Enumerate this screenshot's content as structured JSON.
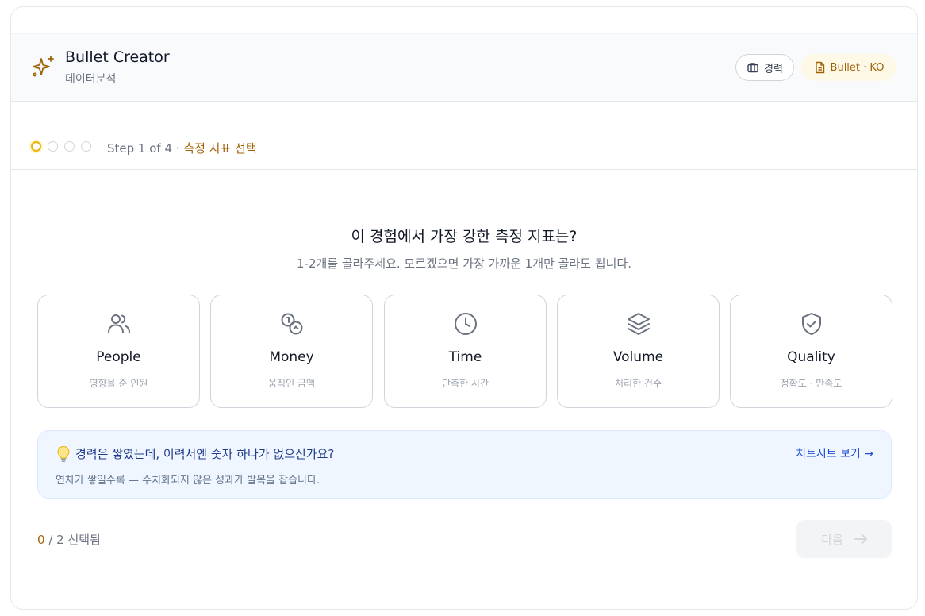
{
  "header": {
    "title": "Bullet Creator",
    "subtitle": "데이터분석",
    "chip_career": "경력",
    "chip_bullet": "Bullet · KO"
  },
  "stepper": {
    "current_step": 1,
    "total_steps": 4,
    "label": "Step 1 of 4 · ",
    "step_name": "측정 지표 선택"
  },
  "main": {
    "question": "이 경험에서 가장 강한 측정 지표는?",
    "hint": "1-2개를 골라주세요. 모르겠으면 가장 가까운 1개만 골라도 됩니다.",
    "metrics": [
      {
        "name": "People",
        "desc": "영향을 준 인원",
        "icon": "people-icon"
      },
      {
        "name": "Money",
        "desc": "움직인 금액",
        "icon": "coins-icon"
      },
      {
        "name": "Time",
        "desc": "단축한 시간",
        "icon": "clock-icon"
      },
      {
        "name": "Volume",
        "desc": "처리한 건수",
        "icon": "layers-icon"
      },
      {
        "name": "Quality",
        "desc": "정확도 · 만족도",
        "icon": "shield-check-icon"
      }
    ]
  },
  "banner": {
    "title": "경력은 쌓였는데, 이력서엔 숫자 하나가 없으신가요?",
    "desc": "연차가 쌓일수록 — 수치화되지 않은 성과가 발목을 잡습니다.",
    "link": "치트시트 보기 →"
  },
  "footer": {
    "selected": "0",
    "of_label": " / 2 선택됨",
    "next_label": "다음"
  },
  "colors": {
    "accent": "#a16207",
    "step_active": "#eab308",
    "banner_bg": "#eff6ff",
    "banner_title": "#1e3a8a"
  }
}
